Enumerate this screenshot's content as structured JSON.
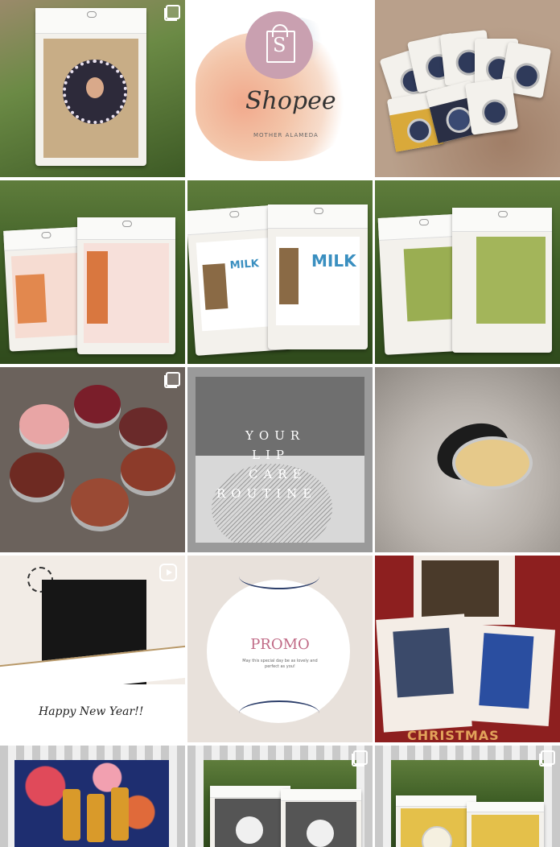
{
  "tiles": [
    {
      "id": "sachet-gold",
      "multi_post": true
    },
    {
      "id": "shopee-logo",
      "brand": "Shopee",
      "sub": "MOTHER ALAMEDA"
    },
    {
      "id": "lip-tins"
    },
    {
      "id": "pink-powder"
    },
    {
      "id": "milk-powder",
      "label": "MILK"
    },
    {
      "id": "green-powder"
    },
    {
      "id": "lip-balms",
      "multi_post": true
    },
    {
      "id": "lip-care",
      "lines": [
        "YOUR",
        "LIP",
        "CARE",
        "ROUTINE"
      ]
    },
    {
      "id": "balm-closeup"
    },
    {
      "id": "new-year-reel",
      "greeting": "Happy New Year!!",
      "reel": true
    },
    {
      "id": "promo",
      "title": "PROMO",
      "body": "May this special day be as lovely and perfect as you!"
    },
    {
      "id": "christmas",
      "title": "CHRISTMAS"
    },
    {
      "id": "floral-oils"
    },
    {
      "id": "dark-sachets",
      "multi_post": true
    },
    {
      "id": "yellow-sachets",
      "multi_post": true
    }
  ],
  "colors": {
    "christmas_red": "#8d1f1f",
    "promo_pink": "#c06a86",
    "shopee_bag": "#c9a0b0"
  }
}
